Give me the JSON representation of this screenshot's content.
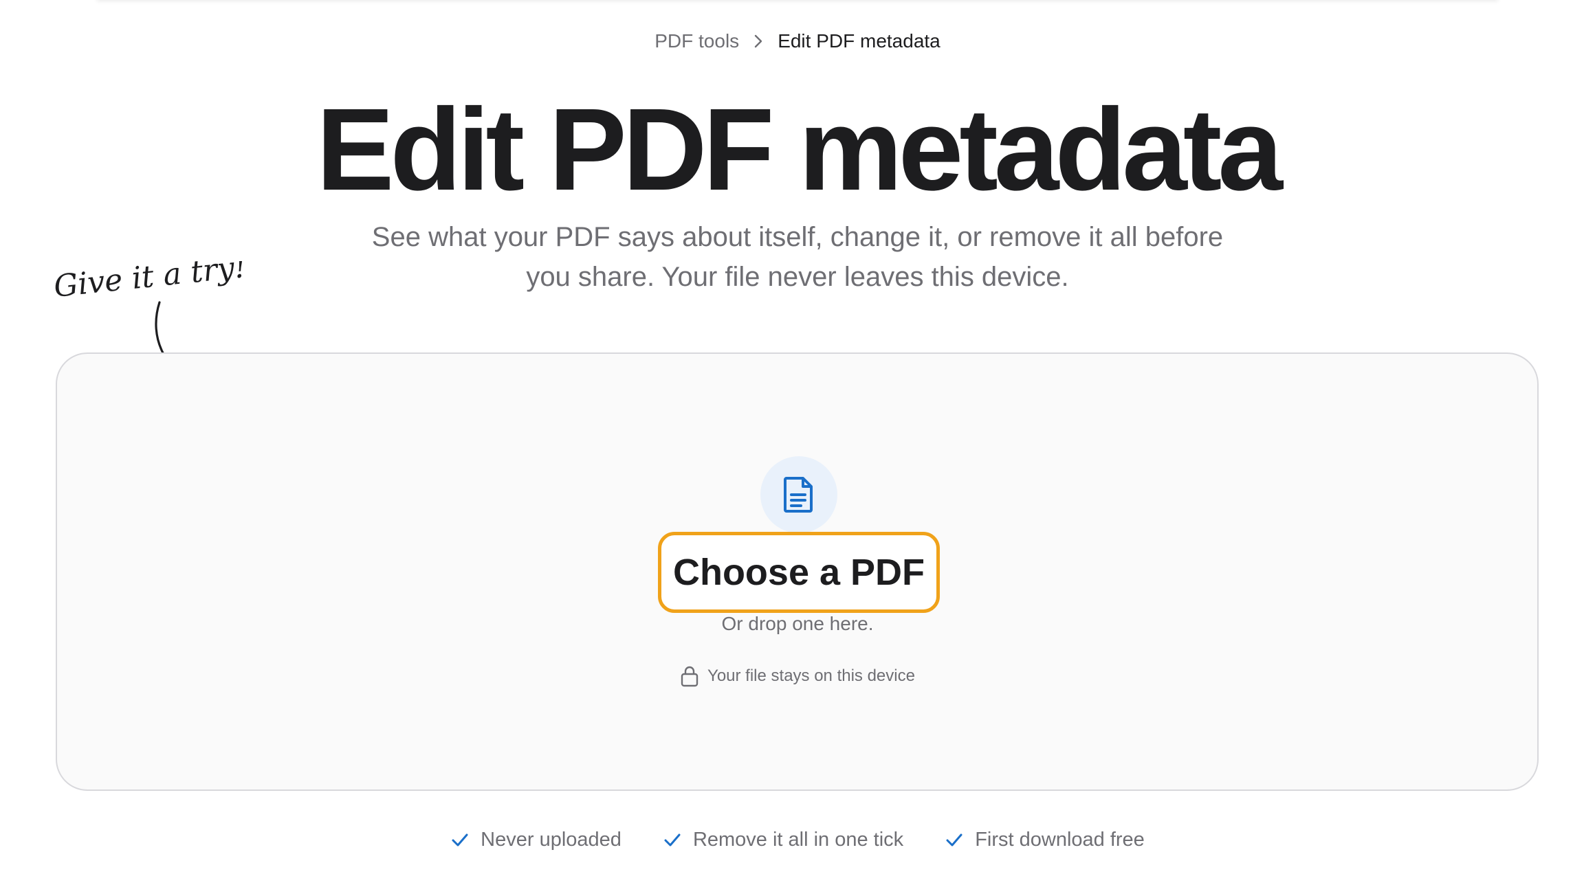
{
  "breadcrumb": {
    "parent_label": "PDF tools",
    "current_label": "Edit PDF metadata",
    "separator_icon": "chevron-right-icon"
  },
  "header": {
    "title": "Edit PDF metadata",
    "subtitle_line1": "See what your PDF says about itself, change it, or remove it all before",
    "subtitle_line2": "you share. Your file never leaves this device."
  },
  "callout": {
    "text": "Give it a try!",
    "icon": "curved-arrow-icon"
  },
  "dropzone": {
    "icon": "document-icon",
    "button_label": "Choose a PDF",
    "hint": "Or drop one here.",
    "privacy_icon": "lock-icon",
    "privacy_text": "Your file stays on this device"
  },
  "features": [
    {
      "icon": "check-icon",
      "label": "Never uploaded"
    },
    {
      "icon": "check-icon",
      "label": "Remove it all in one tick"
    },
    {
      "icon": "check-icon",
      "label": "First download free"
    }
  ],
  "colors": {
    "accent_blue": "#1a6fc9",
    "button_outline": "#f0a21a",
    "icon_bg": "#e9f1fb",
    "text_primary": "#1d1d1f",
    "text_secondary": "#6e6e73"
  }
}
